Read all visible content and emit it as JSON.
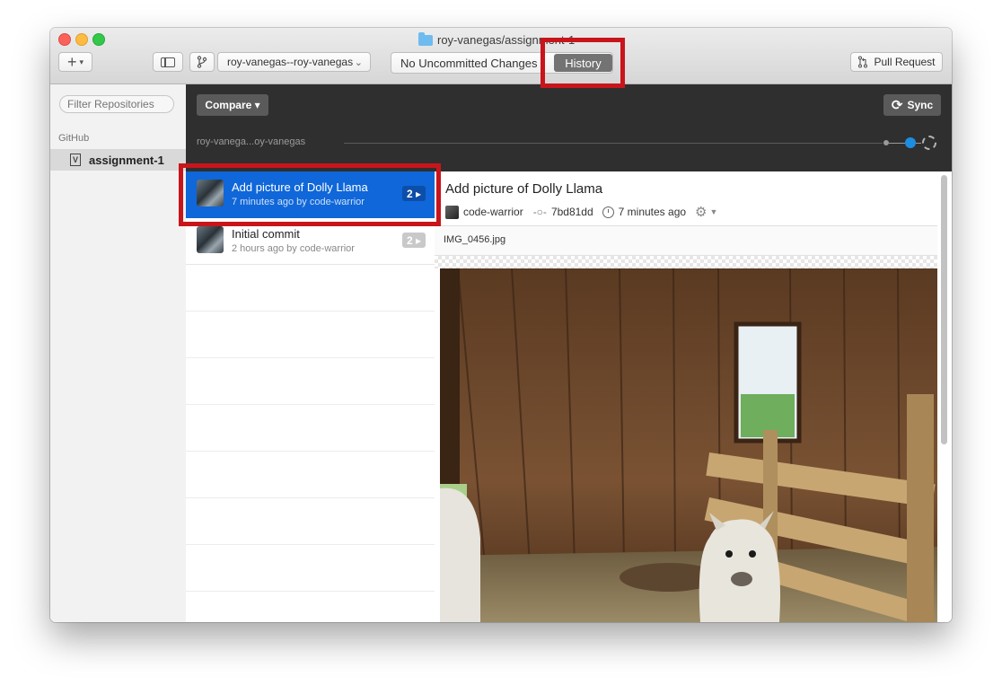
{
  "window": {
    "title": "roy-vanegas/assignment-1"
  },
  "toolbar": {
    "add_label": "+",
    "branch_select": "roy-vanegas--roy-vanegas",
    "branch_chevron": "⌄",
    "segment_changes": "No Uncommitted Changes",
    "segment_history": "History",
    "pull_request_label": "Pull Request"
  },
  "sidebar": {
    "filter_placeholder": "Filter Repositories",
    "section_label": "GitHub",
    "repos": [
      {
        "label": "assignment-1",
        "selected": true
      }
    ]
  },
  "header": {
    "compare_label": "Compare ▾",
    "sync_label": "Sync",
    "branch_label": "roy-vanega...oy-vanegas"
  },
  "commits": [
    {
      "title": "Add picture of Dolly Llama",
      "subtitle": "7 minutes ago by code-warrior",
      "badge": "2 ▸",
      "selected": true
    },
    {
      "title": "Initial commit",
      "subtitle": "2 hours ago by code-warrior",
      "badge": "2 ▸",
      "selected": false
    }
  ],
  "detail": {
    "title": "Add picture of Dolly Llama",
    "author": "code-warrior",
    "hash": "7bd81dd",
    "time": "7 minutes ago",
    "file_name": "IMG_0456.jpg"
  },
  "colors": {
    "selected_blue": "#0f67d9",
    "highlight_red": "#c8151b",
    "dark_header": "#2f2f2f"
  }
}
